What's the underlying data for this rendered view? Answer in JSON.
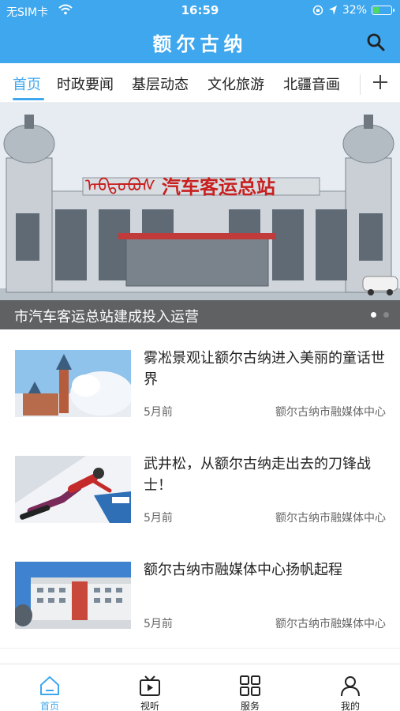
{
  "status_bar": {
    "carrier": "无SIM卡",
    "time": "16:59",
    "battery": "32%",
    "battery_level": 0.32
  },
  "header": {
    "title": "额尔古纳",
    "search_icon": "search-icon"
  },
  "tabs": [
    {
      "label": "首页",
      "active": true
    },
    {
      "label": "时政要闻",
      "active": false
    },
    {
      "label": "基层动态",
      "active": false
    },
    {
      "label": "文化旅游",
      "active": false
    },
    {
      "label": "北疆音画",
      "active": false
    }
  ],
  "tabs_more_icon": "plus-icon",
  "carousel": {
    "image_sign": "汽车客运总站",
    "caption": "市汽车客运总站建成投入运营",
    "slide_count": 2,
    "active_slide": 1
  },
  "news": [
    {
      "title": "雾凇景观让额尔古纳进入美丽的童话世界",
      "time": "5月前",
      "source": "额尔古纳市融媒体中心"
    },
    {
      "title": "武井松，从额尔古纳走出去的刀锋战士！",
      "time": "5月前",
      "source": "额尔古纳市融媒体中心"
    },
    {
      "title": "额尔古纳市融媒体中心扬帆起程",
      "time": "5月前",
      "source": "额尔古纳市融媒体中心"
    }
  ],
  "bottom_nav": [
    {
      "label": "首页",
      "icon": "home-icon",
      "active": true
    },
    {
      "label": "视听",
      "icon": "video-icon",
      "active": false
    },
    {
      "label": "服务",
      "icon": "grid-icon",
      "active": false
    },
    {
      "label": "我的",
      "icon": "user-icon",
      "active": false
    }
  ],
  "colors": {
    "accent": "#3fa7ee",
    "battery_green": "#4cd964"
  }
}
